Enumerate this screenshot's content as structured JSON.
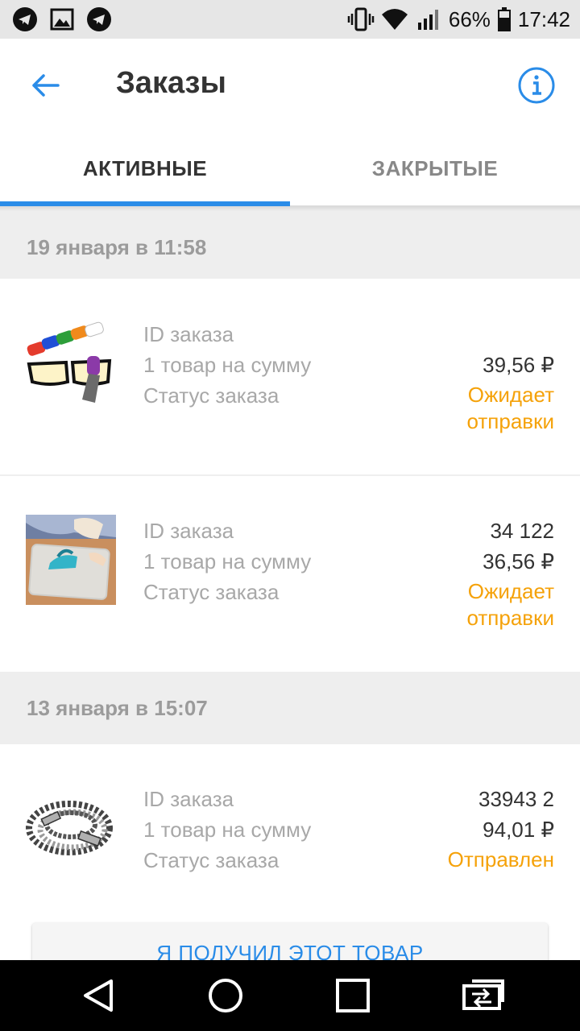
{
  "status_bar": {
    "battery": "66%",
    "time": "17:42",
    "left_icons": [
      "telegram-icon",
      "image-icon",
      "telegram-icon"
    ],
    "right_icons": [
      "vibrate-icon",
      "wifi-icon",
      "signal-icon",
      "battery-icon"
    ]
  },
  "toolbar": {
    "title": "Заказы",
    "back_icon": "arrow-left-icon",
    "info_icon": "info-icon"
  },
  "tabs": [
    {
      "label": "АКТИВНЫЕ",
      "active": true
    },
    {
      "label": "ЗАКРЫТЫЕ",
      "active": false
    }
  ],
  "groups": [
    {
      "date": "19 января в 11:58",
      "orders": [
        {
          "image": "glasses-cleaner",
          "id_label": "ID заказа",
          "id_value": "",
          "sum_label": "1 товар на сумму",
          "price": "39,56 ₽",
          "status_label": "Статус заказа",
          "status_line1": "Ожидает",
          "status_line2": "отправки"
        },
        {
          "image": "ironing-mesh",
          "id_label": "ID заказа",
          "id_value": "34     122",
          "sum_label": "1 товар на сумму",
          "price": "36,56 ₽",
          "status_label": "Статус заказа",
          "status_line1": "Ожидает",
          "status_line2": "отправки"
        }
      ]
    },
    {
      "date": "13 января в 15:07",
      "orders": [
        {
          "image": "braided-cable",
          "id_label": "ID заказа",
          "id_value": "33943      2",
          "sum_label": "1 товар на сумму",
          "price": "94,01 ₽",
          "status_label": "Статус заказа",
          "status_line1": "Отправлен",
          "status_line2": ""
        }
      ]
    }
  ],
  "received_button": "Я ПОЛУЧИЛ ЭТОТ ТОВАР",
  "navbar": [
    "back-triangle-icon",
    "home-circle-icon",
    "recents-square-icon",
    "switch-icon"
  ],
  "colors": {
    "accent": "#2a8ce8",
    "status": "#f5a20a",
    "header_bg": "#eeeeee"
  }
}
